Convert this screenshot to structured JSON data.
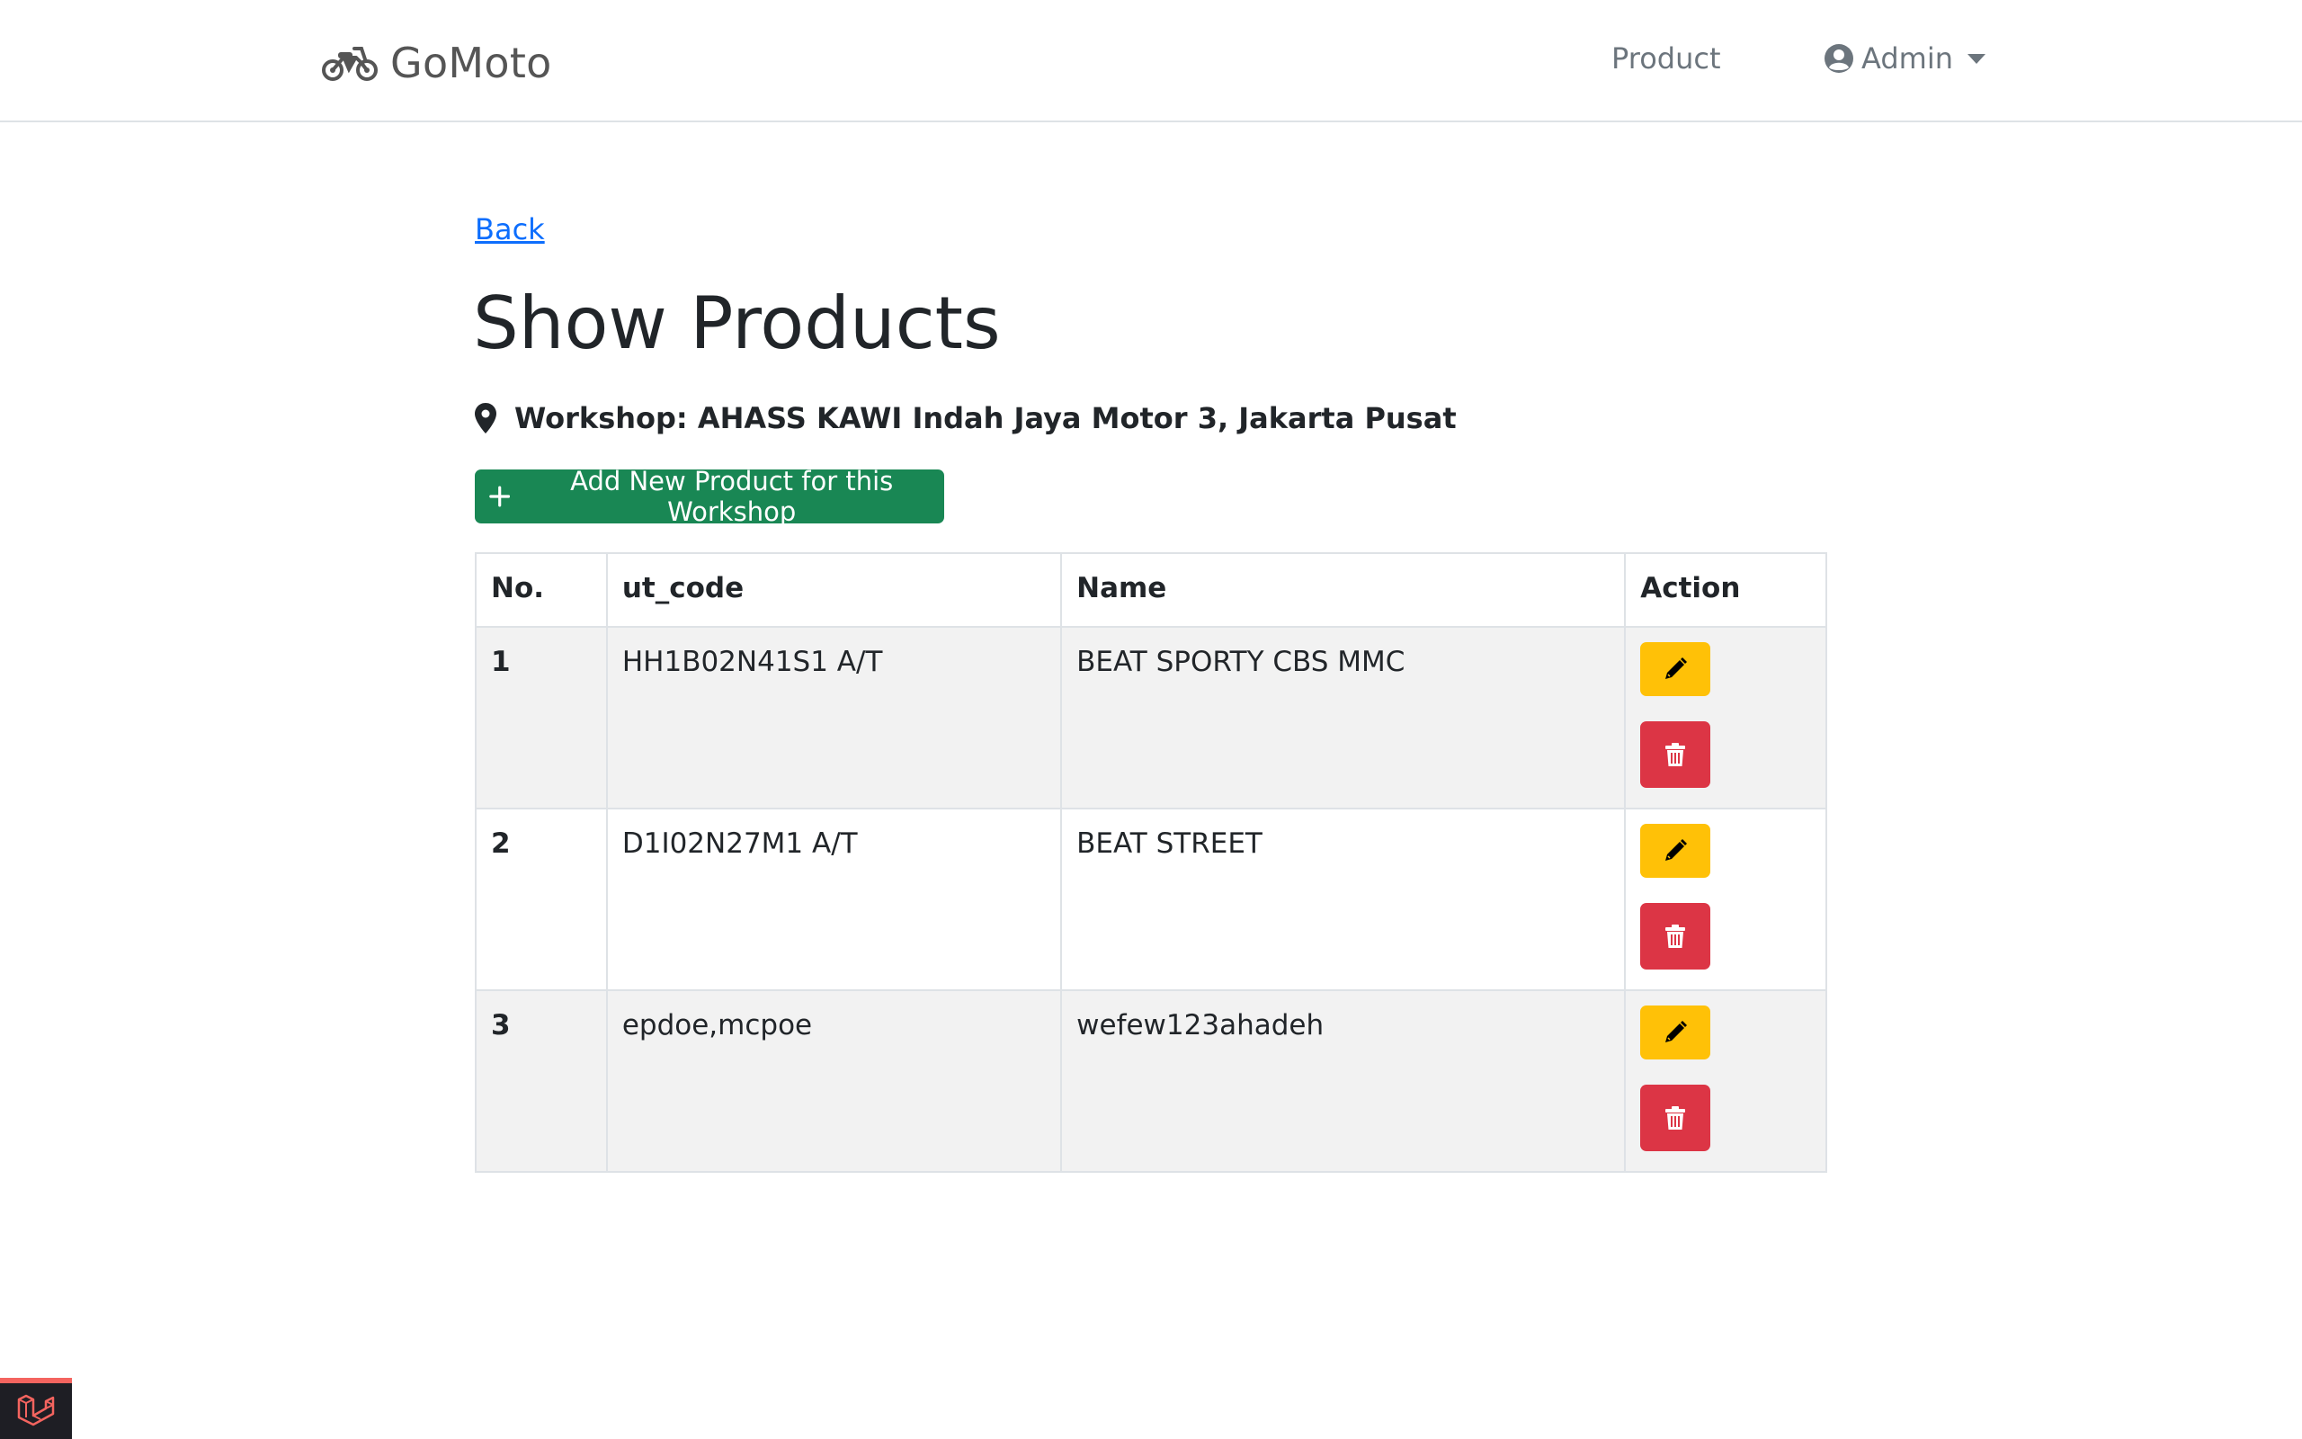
{
  "navbar": {
    "brand": "GoMoto",
    "brand_icon": "motorcycle-icon",
    "links": {
      "product": "Product"
    },
    "user": {
      "label": "Admin",
      "icon": "user-circle-icon"
    }
  },
  "main": {
    "back_label": "Back",
    "title": "Show Products",
    "workshop": {
      "icon": "map-pin-icon",
      "text": "Workshop: AHASS KAWI Indah Jaya Motor 3, Jakarta Pusat"
    },
    "add_button": {
      "label": "Add New Product for this Workshop",
      "icon": "plus-icon"
    }
  },
  "table": {
    "headers": {
      "no": "No.",
      "ut_code": "ut_code",
      "name": "Name",
      "action": "Action"
    },
    "rows": [
      {
        "no": "1",
        "ut_code": "HH1B02N41S1 A/T",
        "name": "BEAT SPORTY CBS MMC"
      },
      {
        "no": "2",
        "ut_code": "D1I02N27M1 A/T",
        "name": "BEAT STREET"
      },
      {
        "no": "3",
        "ut_code": "epdoe,mcpoe",
        "name": "wefew123ahadeh"
      }
    ],
    "action_icons": {
      "edit": "pencil-icon",
      "delete": "trash-icon"
    }
  },
  "colors": {
    "primary_link": "#0d6efd",
    "success": "#198754",
    "warning": "#ffc107",
    "danger": "#dc3545",
    "stripe": "#f2f2f2"
  },
  "debug_badge": {
    "icon": "laravel-logo-icon"
  }
}
